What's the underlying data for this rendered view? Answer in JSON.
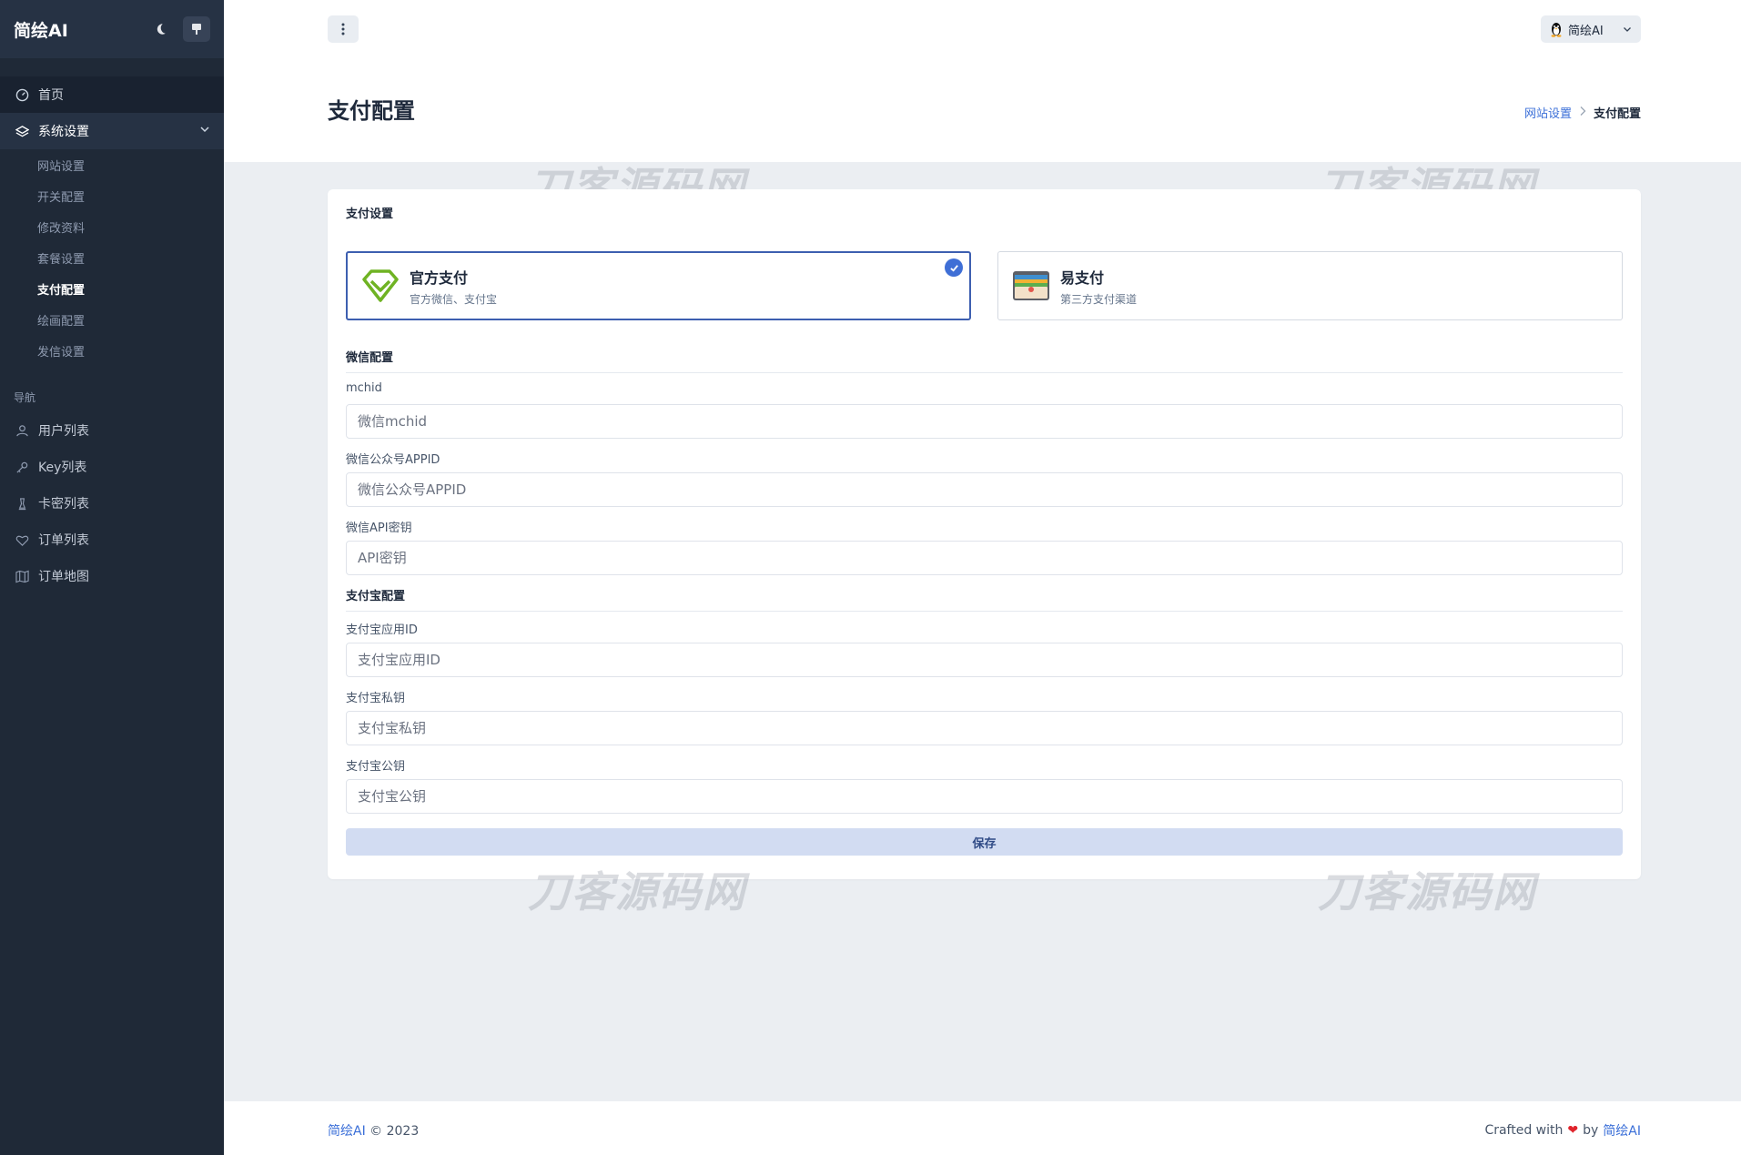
{
  "app": {
    "brand": "简绘AI"
  },
  "sidebar": {
    "items": [
      {
        "label": "首页",
        "icon": "dashboard-icon"
      },
      {
        "label": "系统设置",
        "icon": "layers-icon"
      }
    ],
    "submenu": [
      "网站设置",
      "开关配置",
      "修改资料",
      "套餐设置",
      "支付配置",
      "绘画配置",
      "发信设置"
    ],
    "active_sub": "支付配置",
    "nav_heading": "导航",
    "nav_items": [
      {
        "label": "用户列表",
        "icon": "users-icon"
      },
      {
        "label": "Key列表",
        "icon": "key-icon"
      },
      {
        "label": "卡密列表",
        "icon": "chess-icon"
      },
      {
        "label": "订单列表",
        "icon": "heart-icon"
      },
      {
        "label": "订单地图",
        "icon": "map-icon"
      }
    ]
  },
  "header": {
    "user_name": "简绘AI"
  },
  "page": {
    "title": "支付配置",
    "breadcrumb": {
      "parent": "网站设置",
      "current": "支付配置"
    }
  },
  "card": {
    "title": "支付设置",
    "options": [
      {
        "name": "官方支付",
        "desc": "官方微信、支付宝",
        "selected": true
      },
      {
        "name": "易支付",
        "desc": "第三方支付渠道",
        "selected": false
      }
    ],
    "wechat": {
      "heading": "微信配置",
      "fields": [
        {
          "label": "mchid",
          "placeholder": "微信mchid"
        },
        {
          "label": "微信公众号APPID",
          "placeholder": "微信公众号APPID"
        },
        {
          "label": "微信API密钥",
          "placeholder": "API密钥"
        }
      ]
    },
    "alipay": {
      "heading": "支付宝配置",
      "fields": [
        {
          "label": "支付宝应用ID",
          "placeholder": "支付宝应用ID"
        },
        {
          "label": "支付宝私钥",
          "placeholder": "支付宝私钥"
        },
        {
          "label": "支付宝公钥",
          "placeholder": "支付宝公钥"
        }
      ]
    },
    "save_label": "保存"
  },
  "watermark": "刀客源码网",
  "footer": {
    "brand": "简绘AI",
    "copyright": "© 2023",
    "crafted": "Crafted with",
    "heart": "❤",
    "by": "by",
    "author": "简绘AI"
  },
  "colors": {
    "accent": "#3f6fd6",
    "sidebar": "#1f2937",
    "save_bg": "#d2dcf2"
  }
}
